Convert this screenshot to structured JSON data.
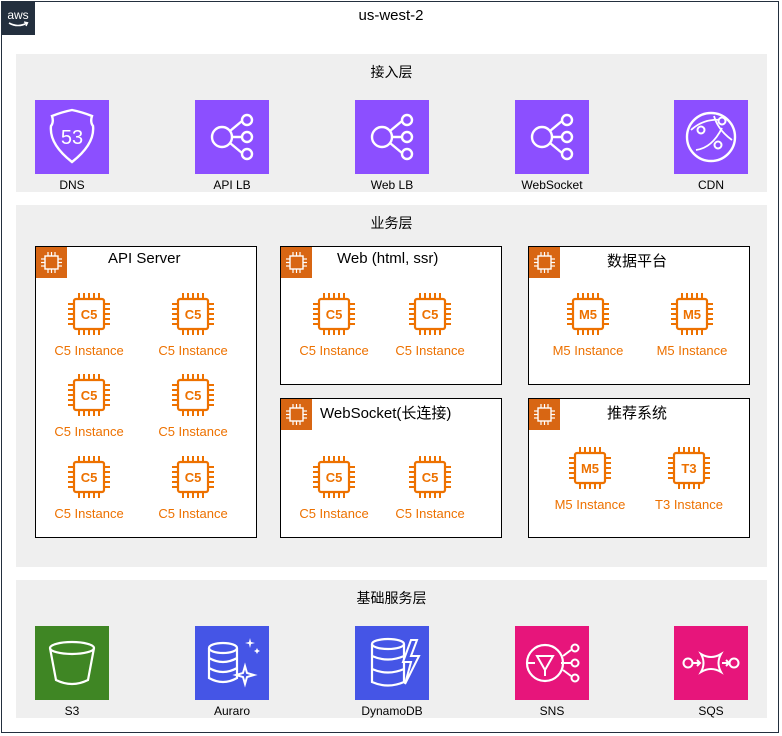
{
  "region": "us-west-2",
  "colors": {
    "aws_dark": "#232f3e",
    "networking_purple": "#8c4fff",
    "storage_green": "#3f8624",
    "database_blue": "#4555e6",
    "app_integration_pink": "#e7157b",
    "compute_orange": "#ed7100",
    "compute_badge": "#d86613",
    "layer_bg": "#efefef"
  },
  "layers": {
    "access": {
      "title": "接入层",
      "services": [
        {
          "label": "DNS",
          "icon": "route53-icon"
        },
        {
          "label": "API LB",
          "icon": "load-balancer-icon"
        },
        {
          "label": "Web LB",
          "icon": "load-balancer-icon"
        },
        {
          "label": "WebSocket",
          "icon": "load-balancer-icon"
        },
        {
          "label": "CDN",
          "icon": "cloudfront-icon"
        }
      ]
    },
    "business": {
      "title": "业务层",
      "groups": {
        "api_server": {
          "title": "API Server",
          "instances": [
            {
              "type": "C5",
              "label": "C5 Instance"
            },
            {
              "type": "C5",
              "label": "C5 Instance"
            },
            {
              "type": "C5",
              "label": "C5 Instance"
            },
            {
              "type": "C5",
              "label": "C5 Instance"
            },
            {
              "type": "C5",
              "label": "C5 Instance"
            },
            {
              "type": "C5",
              "label": "C5 Instance"
            }
          ]
        },
        "web": {
          "title": "Web (html, ssr)",
          "instances": [
            {
              "type": "C5",
              "label": "C5 Instance"
            },
            {
              "type": "C5",
              "label": "C5 Instance"
            }
          ]
        },
        "data_platform": {
          "title": "数据平台",
          "instances": [
            {
              "type": "M5",
              "label": "M5 Instance"
            },
            {
              "type": "M5",
              "label": "M5 Instance"
            }
          ]
        },
        "websocket": {
          "title": "WebSocket(长连接)",
          "instances": [
            {
              "type": "C5",
              "label": "C5 Instance"
            },
            {
              "type": "C5",
              "label": "C5 Instance"
            }
          ]
        },
        "recommend": {
          "title": "推荐系统",
          "instances": [
            {
              "type": "M5",
              "label": "M5 Instance"
            },
            {
              "type": "T3",
              "label": "T3 Instance"
            }
          ]
        }
      }
    },
    "foundation": {
      "title": "基础服务层",
      "services": [
        {
          "label": "S3",
          "icon": "s3-bucket-icon"
        },
        {
          "label": "Auraro",
          "icon": "aurora-icon"
        },
        {
          "label": "DynamoDB",
          "icon": "dynamodb-icon"
        },
        {
          "label": "SNS",
          "icon": "sns-icon"
        },
        {
          "label": "SQS",
          "icon": "sqs-icon"
        }
      ]
    }
  }
}
